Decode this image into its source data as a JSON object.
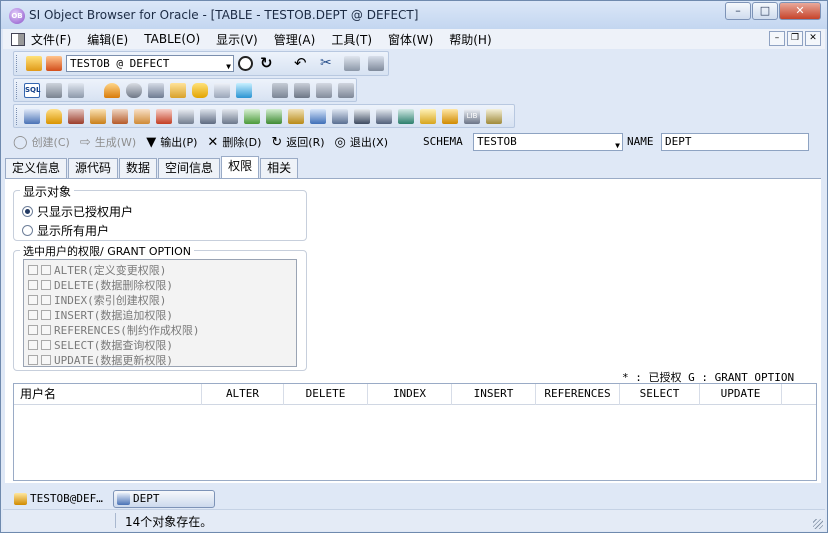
{
  "window": {
    "title": "SI Object Browser for Oracle - [TABLE - TESTOB.DEPT @ DEFECT]",
    "controls": {
      "minimize": "–",
      "maximize": "□",
      "close": "✕"
    }
  },
  "menubar": {
    "items": [
      "文件(F)",
      "编辑(E)",
      "TABLE(O)",
      "显示(V)",
      "管理(A)",
      "工具(T)",
      "窗体(W)",
      "帮助(H)"
    ],
    "mdi_controls": [
      "–",
      "❐",
      "✕"
    ]
  },
  "toolbar1": {
    "connection_combo": "TESTOB @ DEFECT"
  },
  "actions": {
    "create": "创建(C)",
    "generate": "生成(W)",
    "export": "输出(P)",
    "delete": "删除(D)",
    "back": "返回(R)",
    "exit": "退出(X)"
  },
  "schema": {
    "label": "SCHEMA",
    "value": "TESTOB"
  },
  "name_field": {
    "label": "NAME",
    "value": "DEPT"
  },
  "tabs": [
    "定义信息",
    "源代码",
    "数据",
    "空间信息",
    "权限",
    "相关"
  ],
  "active_tab": "权限",
  "display_group": {
    "title": "显示对象",
    "options": [
      "只显示已授权用户",
      "显示所有用户"
    ],
    "selected": "只显示已授权用户"
  },
  "perm_group": {
    "title": "选中用户的权限/ GRANT OPTION",
    "items": [
      "ALTER(定义变更权限)",
      "DELETE(数据删除权限)",
      "INDEX(索引创建权限)",
      "INSERT(数据追加权限)",
      "REFERENCES(制约作成权限)",
      "SELECT(数据查询权限)",
      "UPDATE(数据更新权限)"
    ]
  },
  "legend": "* : 已授权  G : GRANT OPTION",
  "grid": {
    "columns": [
      "用户名",
      "ALTER",
      "DELETE",
      "INDEX",
      "INSERT",
      "REFERENCES",
      "SELECT",
      "UPDATE"
    ]
  },
  "taskbar": {
    "items": [
      "TESTOB@DEF…",
      "DEPT"
    ]
  },
  "status": {
    "text": "14个对象存在。"
  }
}
